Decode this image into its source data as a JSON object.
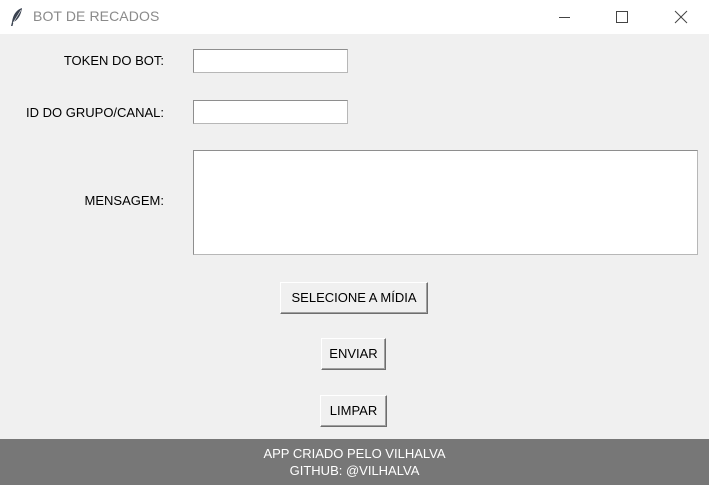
{
  "window": {
    "title": "BOT DE RECADOS",
    "app_icon": "feather-icon",
    "controls": [
      "minimize-icon",
      "maximize-icon",
      "close-icon"
    ]
  },
  "form": {
    "token_label": "TOKEN DO BOT:",
    "token_value": "",
    "grupo_label": "ID DO GRUPO/CANAL:",
    "grupo_value": "",
    "mensagem_label": "MENSAGEM:",
    "mensagem_value": ""
  },
  "buttons": {
    "midia": "SELECIONE A MÍDIA",
    "enviar": "ENVIAR",
    "limpar": "LIMPAR"
  },
  "footer": {
    "line1": "APP CRIADO PELO VILHALVA",
    "line2": "GITHUB: @VILHALVA"
  },
  "colors": {
    "window_bg": "#f0f0f0",
    "titlebar_bg": "#ffffff",
    "footer_bg": "#777777",
    "footer_text": "#ffffff"
  }
}
